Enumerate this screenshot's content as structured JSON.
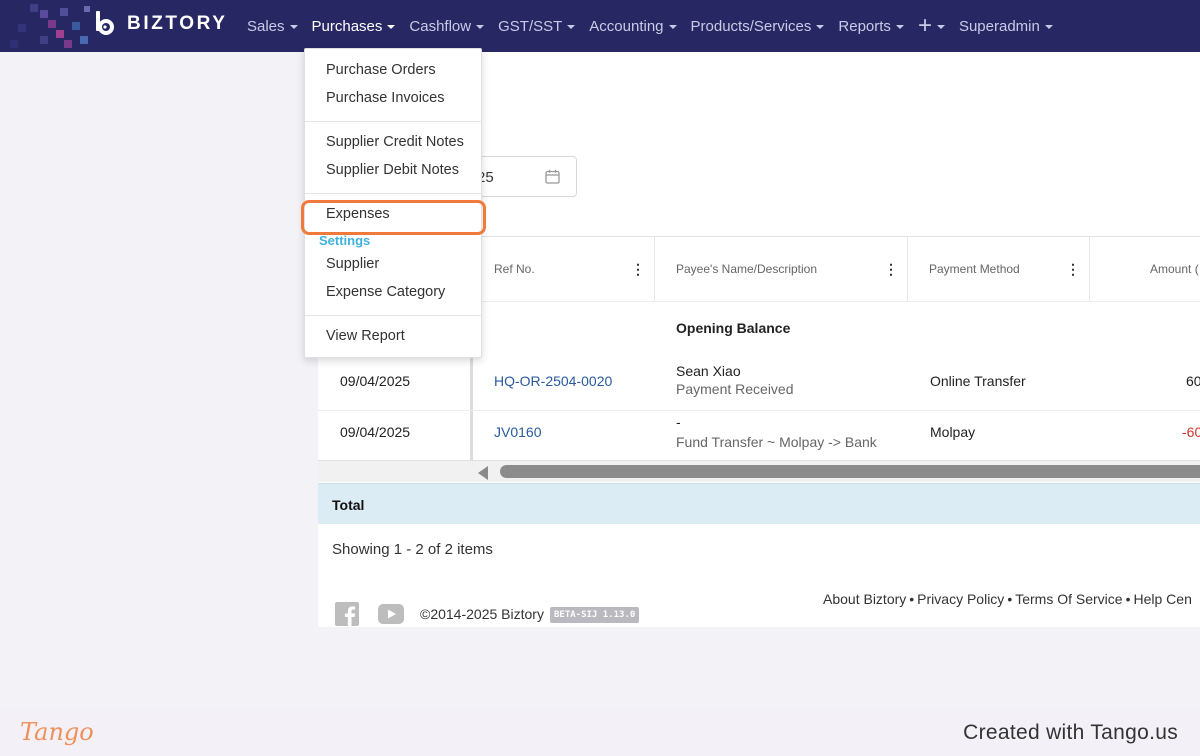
{
  "brand": {
    "name": "BIZTORY"
  },
  "nav": {
    "items": [
      {
        "label": "Sales",
        "active": false,
        "has_caret": true
      },
      {
        "label": "Purchases",
        "active": true,
        "has_caret": true
      },
      {
        "label": "Cashflow",
        "active": false,
        "has_caret": true
      },
      {
        "label": "GST/SST",
        "active": false,
        "has_caret": true
      },
      {
        "label": "Accounting",
        "active": false,
        "has_caret": true
      },
      {
        "label": "Products/Services",
        "active": false,
        "has_caret": true
      },
      {
        "label": "Reports",
        "active": false,
        "has_caret": true
      },
      {
        "label": "+",
        "active": false,
        "has_caret": true,
        "icon": "plus-icon"
      },
      {
        "label": "Superadmin",
        "active": false,
        "has_caret": true
      }
    ]
  },
  "dropdown": {
    "items": {
      "purchase_orders": "Purchase Orders",
      "purchase_invoices": "Purchase Invoices",
      "supplier_credit_notes": "Supplier Credit Notes",
      "supplier_debit_notes": "Supplier Debit Notes",
      "expenses": "Expenses",
      "settings_heading": "Settings",
      "supplier": "Supplier",
      "expense_category": "Expense Category",
      "view_report": "View Report"
    },
    "highlighted": "Expenses"
  },
  "filter": {
    "date_fragment": "25",
    "icon": "calendar-icon"
  },
  "table": {
    "columns": {
      "ref_no": "Ref No.",
      "payee": "Payee's Name/Description",
      "payment_method": "Payment Method",
      "amount": "Amount ("
    },
    "opening_balance": "Opening Balance",
    "rows": [
      {
        "date": "09/04/2025",
        "ref": "HQ-OR-2504-0020",
        "payee": "Sean Xiao",
        "description": "Payment Received",
        "method": "Online Transfer",
        "amount": "60"
      },
      {
        "date": "09/04/2025",
        "ref": "JV0160",
        "payee": "-",
        "description": "Fund Transfer ~ Molpay -> Bank",
        "method": "Molpay",
        "amount": "-60"
      }
    ],
    "total_label": "Total",
    "paging": "Showing 1 - 2 of 2 items"
  },
  "footer": {
    "copyright": "©2014-2025 Biztory",
    "version": "BETA-SIJ 1.13.0",
    "links": [
      "About Biztory",
      "Privacy Policy",
      "Terms Of Service",
      "Help Cen"
    ],
    "social_icons": [
      "facebook-icon",
      "youtube-icon"
    ]
  },
  "tango": {
    "logo": "Tango",
    "credit": "Created with Tango.us"
  },
  "colors": {
    "nav_bg": "#272764",
    "accent_highlight": "#f07a3c",
    "link": "#2a5aa0",
    "negative": "#d3332c",
    "settings_heading": "#3fb2e0"
  }
}
